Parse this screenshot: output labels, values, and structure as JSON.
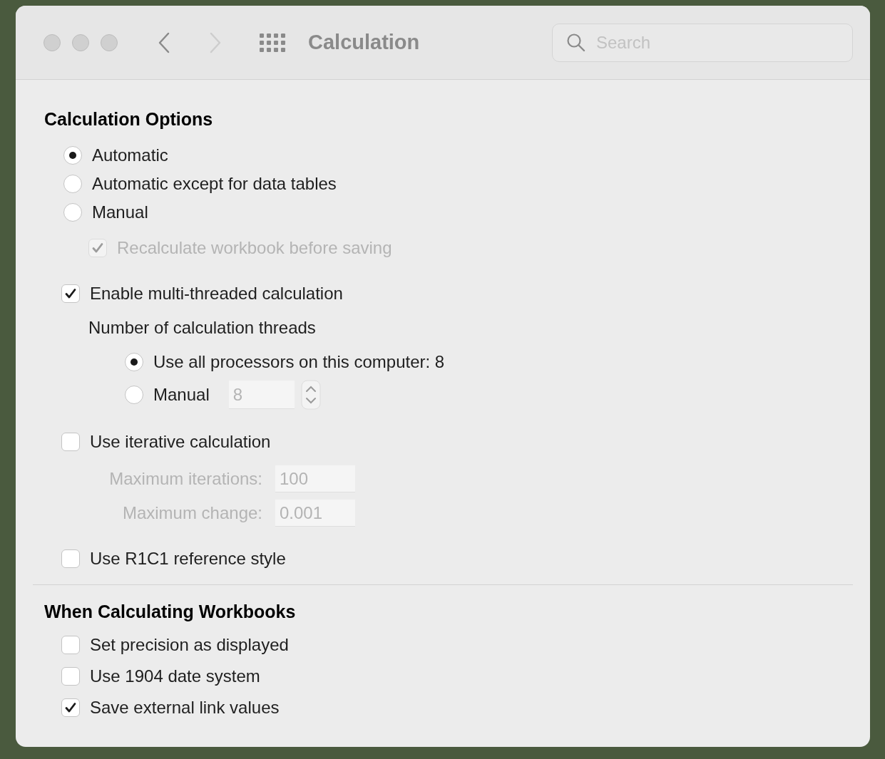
{
  "window": {
    "title": "Calculation",
    "back_enabled": true,
    "forward_enabled": false
  },
  "search": {
    "placeholder": "Search"
  },
  "calculation_options": {
    "title": "Calculation Options",
    "modes": [
      {
        "label": "Automatic",
        "selected": true
      },
      {
        "label": "Automatic except for data tables",
        "selected": false
      },
      {
        "label": "Manual",
        "selected": false
      }
    ],
    "recalculate": {
      "label": "Recalculate workbook before saving",
      "checked": true,
      "disabled": true
    },
    "multithreaded": {
      "label": "Enable multi-threaded calculation",
      "checked": true
    },
    "threads_heading": "Number of calculation threads",
    "thread_options": [
      {
        "kind": "radio",
        "label": "Use all processors on this computer: 8",
        "selected": true
      },
      {
        "kind": "stepper",
        "label": "Manual",
        "selected": false,
        "value": "8",
        "disabled": true
      }
    ],
    "iterative": {
      "label": "Use iterative calculation",
      "checked": false
    },
    "iteration_fields": [
      {
        "label": "Maximum iterations:",
        "value": "100",
        "disabled": true
      },
      {
        "label": "Maximum change:",
        "value": "0.001",
        "disabled": true
      }
    ],
    "r1c1": {
      "label": "Use R1C1 reference style",
      "checked": false
    }
  },
  "workbooks": {
    "title": "When Calculating Workbooks",
    "options": [
      {
        "label": "Set precision as displayed",
        "checked": false
      },
      {
        "label": "Use 1904 date system",
        "checked": false
      },
      {
        "label": "Save external link values",
        "checked": true
      }
    ]
  }
}
